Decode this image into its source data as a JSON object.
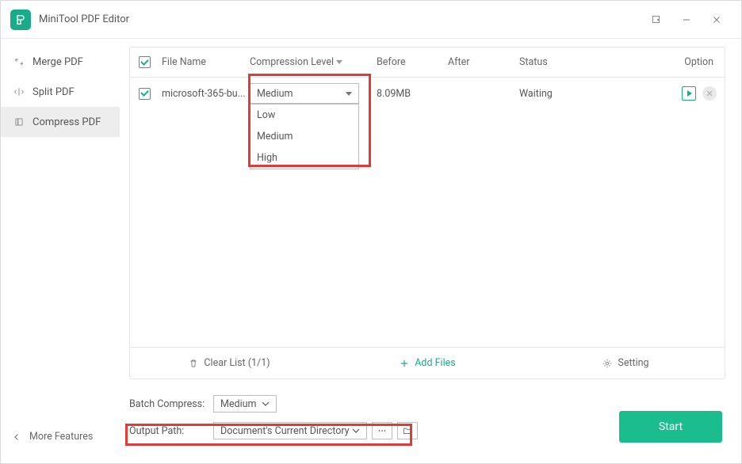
{
  "app": {
    "title": "MiniTool PDF Editor"
  },
  "sidebar": {
    "items": [
      {
        "label": "Merge PDF"
      },
      {
        "label": "Split PDF"
      },
      {
        "label": "Compress PDF"
      }
    ]
  },
  "more_features_label": "More Features",
  "table": {
    "headers": {
      "file_name": "File Name",
      "level": "Compression Level",
      "before": "Before",
      "after": "After",
      "status": "Status",
      "option": "Option"
    },
    "rows": [
      {
        "file_name": "microsoft-365-bu...",
        "level": "Medium",
        "before": "8.09MB",
        "after": "",
        "status": "Waiting"
      }
    ],
    "dropdown_options": [
      "Low",
      "Medium",
      "High"
    ],
    "footer": {
      "clear": "Clear List (1/1)",
      "add": "Add Files",
      "setting": "Setting"
    }
  },
  "batch": {
    "label": "Batch Compress:",
    "value": "Medium"
  },
  "output": {
    "label": "Output Path:",
    "value": "Document's Current Directory"
  },
  "start_label": "Start"
}
